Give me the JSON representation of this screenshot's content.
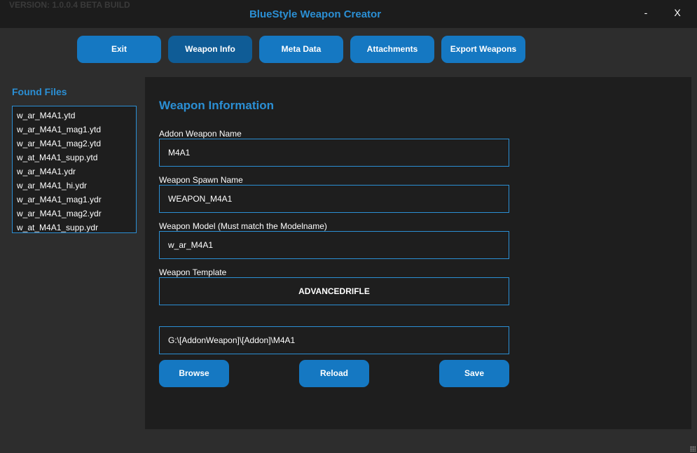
{
  "window": {
    "version": "VERSION: 1.0.0.4 BETA BUILD",
    "title": "BlueStyle Weapon Creator",
    "minimize_label": "-",
    "close_label": "X"
  },
  "nav": {
    "items": [
      {
        "label": "Exit"
      },
      {
        "label": "Weapon Info"
      },
      {
        "label": "Meta Data"
      },
      {
        "label": "Attachments"
      },
      {
        "label": "Export Weapons"
      }
    ],
    "active": "Weapon Info"
  },
  "sidebar": {
    "title": "Found Files",
    "files": [
      "w_ar_M4A1.ytd",
      "w_ar_M4A1_mag1.ytd",
      "w_ar_M4A1_mag2.ytd",
      "w_at_M4A1_supp.ytd",
      "w_ar_M4A1.ydr",
      "w_ar_M4A1_hi.ydr",
      "w_ar_M4A1_mag1.ydr",
      "w_ar_M4A1_mag2.ydr",
      "w_at_M4A1_supp.ydr"
    ]
  },
  "main": {
    "title": "Weapon Information",
    "fields": {
      "addon_name": {
        "label": "Addon Weapon Name",
        "value": "M4A1"
      },
      "spawn_name": {
        "label": "Weapon Spawn Name",
        "value": "WEAPON_M4A1"
      },
      "model": {
        "label": "Weapon Model (Must match the Modelname)",
        "value": "w_ar_M4A1"
      },
      "template": {
        "label": "Weapon Template",
        "value": "ADVANCEDRIFLE"
      },
      "path": {
        "value": "G:\\[AddonWeapon]\\[Addon]\\M4A1"
      }
    },
    "buttons": {
      "browse": "Browse",
      "reload": "Reload",
      "save": "Save"
    }
  },
  "colors": {
    "accent": "#2b8fd4",
    "button": "#1578c2",
    "button_active": "#0f5c96",
    "background": "#2d2d2d",
    "panel": "#1e1e1e"
  }
}
